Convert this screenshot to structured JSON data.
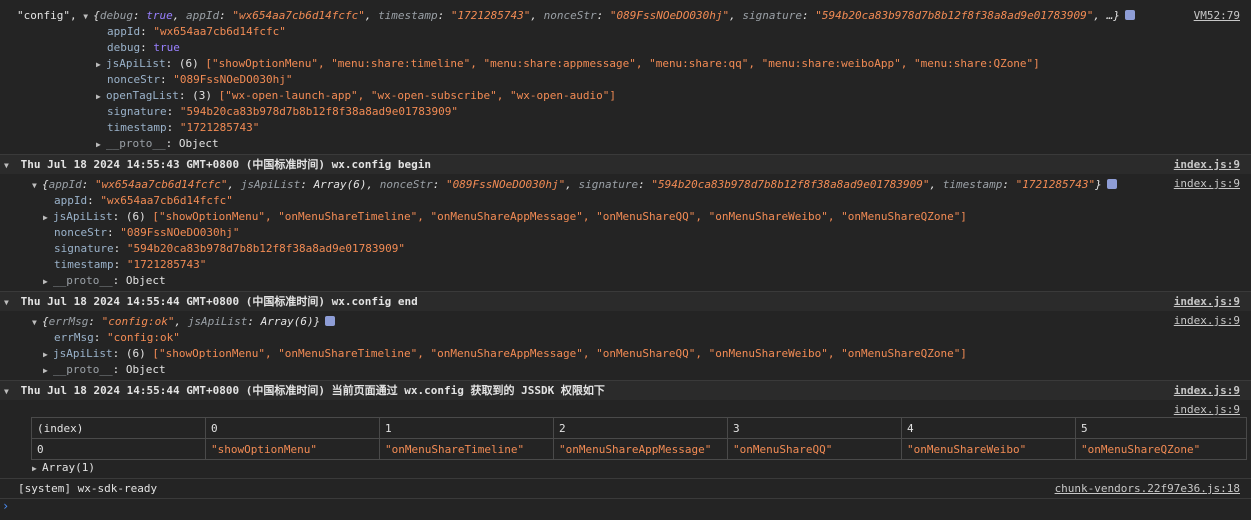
{
  "log0": {
    "prefix": "\"config\",",
    "preview": {
      "open": "{",
      "debug_key": "debug",
      "debug_val": "true",
      "appId_key": "appId",
      "appId_val": "\"wx654aa7cb6d14fcfc\"",
      "timestamp_key": "timestamp",
      "timestamp_val": "\"1721285743\"",
      "nonceStr_key": "nonceStr",
      "nonceStr_val": "\"089FssNOeDO030hj\"",
      "signature_key": "signature",
      "signature_val": "\"594b20ca83b978d7b8b12f8f38a8ad9e01783909\"",
      "ellipsis": "…}"
    },
    "source": "VM52:79",
    "props": {
      "appId": "\"wx654aa7cb6d14fcfc\"",
      "debug": "true",
      "jsApiList_count": "(6)",
      "jsApiList_items": "[\"showOptionMenu\", \"menu:share:timeline\", \"menu:share:appmessage\", \"menu:share:qq\", \"menu:share:weiboApp\", \"menu:share:QZone\"]",
      "nonceStr": "\"089FssNOeDO030hj\"",
      "openTagList_count": "(3)",
      "openTagList_items": "[\"wx-open-launch-app\", \"wx-open-subscribe\", \"wx-open-audio\"]",
      "signature": "\"594b20ca83b978d7b8b12f8f38a8ad9e01783909\"",
      "timestamp": "\"1721285743\"",
      "proto": "Object"
    }
  },
  "keys": {
    "appId": "appId",
    "debug": "debug",
    "jsApiList": "jsApiList",
    "nonceStr": "nonceStr",
    "openTagList": "openTagList",
    "signature": "signature",
    "timestamp": "timestamp",
    "proto": "__proto__",
    "errMsg": "errMsg"
  },
  "group1": {
    "title": "Thu Jul 18 2024 14:55:43 GMT+0800 (中国标准时间) wx.config begin",
    "source": "index.js:9",
    "preview": {
      "appId_val": "\"wx654aa7cb6d14fcfc\"",
      "jsApiList_val": "Array(6)",
      "nonceStr_val": "\"089FssNOeDO030hj\"",
      "signature_val": "\"594b20ca83b978d7b8b12f8f38a8ad9e01783909\"",
      "timestamp_val": "\"1721285743\""
    },
    "source_obj": "index.js:9",
    "props": {
      "appId": "\"wx654aa7cb6d14fcfc\"",
      "jsApiList_count": "(6)",
      "jsApiList_items": "[\"showOptionMenu\", \"onMenuShareTimeline\", \"onMenuShareAppMessage\", \"onMenuShareQQ\", \"onMenuShareWeibo\", \"onMenuShareQZone\"]",
      "nonceStr": "\"089FssNOeDO030hj\"",
      "signature": "\"594b20ca83b978d7b8b12f8f38a8ad9e01783909\"",
      "timestamp": "\"1721285743\"",
      "proto": "Object"
    }
  },
  "group2": {
    "title": "Thu Jul 18 2024 14:55:44 GMT+0800 (中国标准时间) wx.config end",
    "source": "index.js:9",
    "preview": {
      "errMsg_val": "\"config:ok\"",
      "jsApiList_val": "Array(6)"
    },
    "source_obj": "index.js:9",
    "props": {
      "errMsg": "\"config:ok\"",
      "jsApiList_count": "(6)",
      "jsApiList_items": "[\"showOptionMenu\", \"onMenuShareTimeline\", \"onMenuShareAppMessage\", \"onMenuShareQQ\", \"onMenuShareWeibo\", \"onMenuShareQZone\"]",
      "proto": "Object"
    }
  },
  "group3": {
    "title": "Thu Jul 18 2024 14:55:44 GMT+0800 (中国标准时间) 当前页面通过 wx.config 获取到的 JSSDK 权限如下",
    "source": "index.js:9",
    "source_table": "index.js:9",
    "table": {
      "headers": [
        "(index)",
        "0",
        "1",
        "2",
        "3",
        "4",
        "5"
      ],
      "rows": [
        [
          "0",
          "\"showOptionMenu\"",
          "\"onMenuShareTimeline\"",
          "\"onMenuShareAppMessage\"",
          "\"onMenuShareQQ\"",
          "\"onMenuShareWeibo\"",
          "\"onMenuShareQZone\""
        ]
      ]
    },
    "array_label": "Array(1)"
  },
  "system": {
    "text": "[system] wx-sdk-ready",
    "source": "chunk-vendors.22f97e36.js:18"
  },
  "prompt": "›",
  "icons": {
    "expanded": "expand-triangle-icon",
    "collapsed": "collapse-triangle-icon",
    "info": "info-badge-icon",
    "prompt": "prompt-chevron-icon"
  }
}
